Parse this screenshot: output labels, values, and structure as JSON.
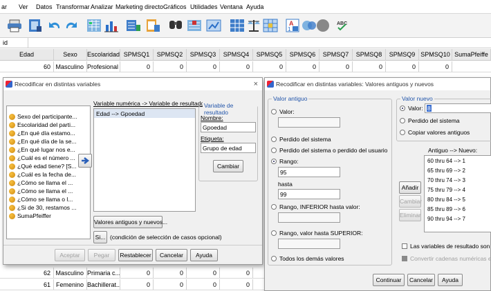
{
  "menu": [
    "ar",
    "Ver",
    "Datos",
    "Transformar",
    "Analizar",
    "Marketing directo",
    "Gráficos",
    "Utilidades",
    "Ventana",
    "Ayuda"
  ],
  "cell_ref": "id",
  "grid": {
    "columns": [
      "Edad",
      "Sexo",
      "Escolaridad",
      "SPMSQ1",
      "SPMSQ2",
      "SPMSQ3",
      "SPMSQ4",
      "SPMSQ5",
      "SPMSQ6",
      "SPMSQ7",
      "SPMSQ8",
      "SPMSQ9",
      "SPMSQ10",
      "SumaPfeiffe"
    ],
    "row1": [
      "60",
      "Masculino",
      "Profesional",
      "0",
      "0",
      "0",
      "0",
      "0",
      "0",
      "0",
      "0",
      "0",
      "0",
      ""
    ],
    "row2": [
      "62",
      "Masculino",
      "Primaria c...",
      "0",
      "0",
      "0",
      "0"
    ],
    "row3": [
      "61",
      "Femenino",
      "Bachillerat...",
      "0",
      "0",
      "0",
      "0"
    ]
  },
  "dlg1": {
    "title": "Recodificar en distintas variables",
    "vars": [
      "Sexo del participante...",
      "Escolaridad del parti...",
      "¿En qué día estamo...",
      "¿En qué día de la se...",
      "¿En qué lugar nos e...",
      "¿Cuál es el número ...",
      "¿Qué edad tiene? [S...",
      "¿Cuál es la fecha de...",
      "¿Cómo se llama el ...",
      "¿Cómo se llama el ...",
      "¿Cómo se llama o l...",
      "¿Si de 30, restamos ...",
      "SumaPfeiffer"
    ],
    "map_label": "Variable numérica -> Variable de resultado:",
    "map_value": "Edad --> Gpoedad",
    "out_legend": "Variable de resultado",
    "name_label": "Nombre:",
    "name_value": "Gpoedad",
    "tag_label": "Etiqueta:",
    "tag_value": "Grupo de edad",
    "change": "Cambiar",
    "old_new": "Valores antiguos y nuevos...",
    "if_btn": "Si...",
    "if_text": "(condición de selección de casos opcional)",
    "accept": "Aceptar",
    "paste": "Pegar",
    "reset": "Restablecer",
    "cancel": "Cancelar",
    "help": "Ayuda",
    "close": "×"
  },
  "dlg2": {
    "title": "Recodificar en distintas variables: Valores antiguos y nuevos",
    "old_legend": "Valor antiguo",
    "opt_value": "Valor:",
    "opt_sysmis": "Perdido del sistema",
    "opt_usermis": "Perdido del sistema o perdido del usuario",
    "opt_range": "Rango:",
    "range_from": "95",
    "through": "hasta",
    "range_to": "99",
    "opt_lowest": "Rango, INFERIOR hasta valor:",
    "opt_highest": "Rango, valor hasta SUPERIOR:",
    "opt_all": "Todos los demás valores",
    "new_legend": "Valor nuevo",
    "new_value": "Valor:",
    "new_value_input": "8",
    "new_sysmis": "Perdido del sistema",
    "new_copy": "Copiar valores antiguos",
    "list_header": "Antiguo --> Nuevo:",
    "list": [
      "60 thru 64 --> 1",
      "65 thru 69 --> 2",
      "70 thru 74 --> 3",
      "75 thru 79 --> 4",
      "80 thru 84 --> 5",
      "85 thru 89 --> 6",
      "90 thru 94 --> 7"
    ],
    "add": "Añadir",
    "change": "Cambiar",
    "remove": "Eliminar",
    "chk_string": "Las variables de resultado son ca",
    "chk_convert": "Convertir cadenas numéricas en",
    "continue": "Continuar",
    "cancel": "Cancelar",
    "help": "Ayuda"
  },
  "colors": {
    "accent": "#2255aa",
    "toolbar": "#f3f3f3",
    "dialog": "#f0f0f0"
  },
  "icons": [
    "print-icon",
    "data-editor-icon",
    "undo-icon",
    "redo-icon",
    "goto-case-icon",
    "chart-icon",
    "variables-icon",
    "report-icon",
    "find-icon",
    "split-icon",
    "weight-icon",
    "table-icon",
    "scale-icon",
    "grid-icon",
    "value-labels-icon",
    "sets-icon",
    "circles-icon",
    "abc-icon"
  ]
}
